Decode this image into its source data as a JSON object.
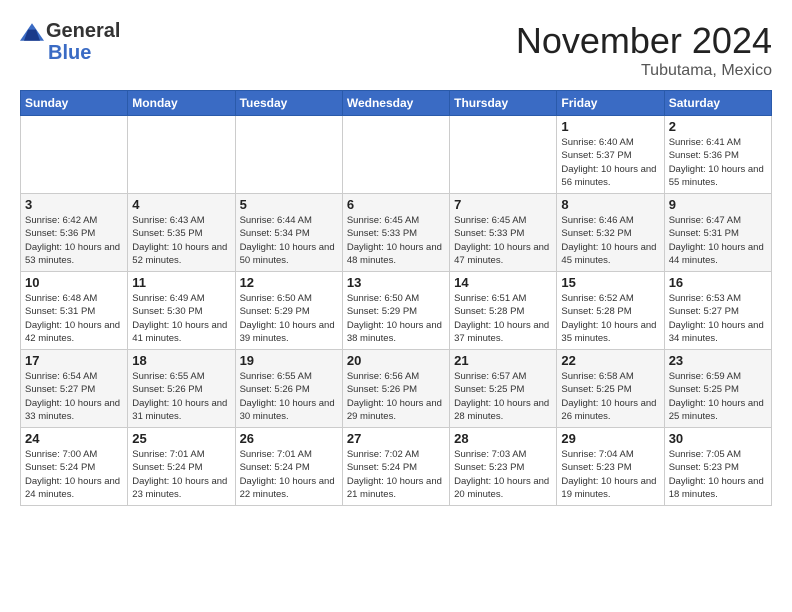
{
  "header": {
    "logo_general": "General",
    "logo_blue": "Blue",
    "month_title": "November 2024",
    "location": "Tubutama, Mexico"
  },
  "weekdays": [
    "Sunday",
    "Monday",
    "Tuesday",
    "Wednesday",
    "Thursday",
    "Friday",
    "Saturday"
  ],
  "weeks": [
    [
      {
        "day": "",
        "sunrise": "",
        "sunset": "",
        "daylight": ""
      },
      {
        "day": "",
        "sunrise": "",
        "sunset": "",
        "daylight": ""
      },
      {
        "day": "",
        "sunrise": "",
        "sunset": "",
        "daylight": ""
      },
      {
        "day": "",
        "sunrise": "",
        "sunset": "",
        "daylight": ""
      },
      {
        "day": "",
        "sunrise": "",
        "sunset": "",
        "daylight": ""
      },
      {
        "day": "1",
        "sunrise": "Sunrise: 6:40 AM",
        "sunset": "Sunset: 5:37 PM",
        "daylight": "Daylight: 10 hours and 56 minutes."
      },
      {
        "day": "2",
        "sunrise": "Sunrise: 6:41 AM",
        "sunset": "Sunset: 5:36 PM",
        "daylight": "Daylight: 10 hours and 55 minutes."
      }
    ],
    [
      {
        "day": "3",
        "sunrise": "Sunrise: 6:42 AM",
        "sunset": "Sunset: 5:36 PM",
        "daylight": "Daylight: 10 hours and 53 minutes."
      },
      {
        "day": "4",
        "sunrise": "Sunrise: 6:43 AM",
        "sunset": "Sunset: 5:35 PM",
        "daylight": "Daylight: 10 hours and 52 minutes."
      },
      {
        "day": "5",
        "sunrise": "Sunrise: 6:44 AM",
        "sunset": "Sunset: 5:34 PM",
        "daylight": "Daylight: 10 hours and 50 minutes."
      },
      {
        "day": "6",
        "sunrise": "Sunrise: 6:45 AM",
        "sunset": "Sunset: 5:33 PM",
        "daylight": "Daylight: 10 hours and 48 minutes."
      },
      {
        "day": "7",
        "sunrise": "Sunrise: 6:45 AM",
        "sunset": "Sunset: 5:33 PM",
        "daylight": "Daylight: 10 hours and 47 minutes."
      },
      {
        "day": "8",
        "sunrise": "Sunrise: 6:46 AM",
        "sunset": "Sunset: 5:32 PM",
        "daylight": "Daylight: 10 hours and 45 minutes."
      },
      {
        "day": "9",
        "sunrise": "Sunrise: 6:47 AM",
        "sunset": "Sunset: 5:31 PM",
        "daylight": "Daylight: 10 hours and 44 minutes."
      }
    ],
    [
      {
        "day": "10",
        "sunrise": "Sunrise: 6:48 AM",
        "sunset": "Sunset: 5:31 PM",
        "daylight": "Daylight: 10 hours and 42 minutes."
      },
      {
        "day": "11",
        "sunrise": "Sunrise: 6:49 AM",
        "sunset": "Sunset: 5:30 PM",
        "daylight": "Daylight: 10 hours and 41 minutes."
      },
      {
        "day": "12",
        "sunrise": "Sunrise: 6:50 AM",
        "sunset": "Sunset: 5:29 PM",
        "daylight": "Daylight: 10 hours and 39 minutes."
      },
      {
        "day": "13",
        "sunrise": "Sunrise: 6:50 AM",
        "sunset": "Sunset: 5:29 PM",
        "daylight": "Daylight: 10 hours and 38 minutes."
      },
      {
        "day": "14",
        "sunrise": "Sunrise: 6:51 AM",
        "sunset": "Sunset: 5:28 PM",
        "daylight": "Daylight: 10 hours and 37 minutes."
      },
      {
        "day": "15",
        "sunrise": "Sunrise: 6:52 AM",
        "sunset": "Sunset: 5:28 PM",
        "daylight": "Daylight: 10 hours and 35 minutes."
      },
      {
        "day": "16",
        "sunrise": "Sunrise: 6:53 AM",
        "sunset": "Sunset: 5:27 PM",
        "daylight": "Daylight: 10 hours and 34 minutes."
      }
    ],
    [
      {
        "day": "17",
        "sunrise": "Sunrise: 6:54 AM",
        "sunset": "Sunset: 5:27 PM",
        "daylight": "Daylight: 10 hours and 33 minutes."
      },
      {
        "day": "18",
        "sunrise": "Sunrise: 6:55 AM",
        "sunset": "Sunset: 5:26 PM",
        "daylight": "Daylight: 10 hours and 31 minutes."
      },
      {
        "day": "19",
        "sunrise": "Sunrise: 6:55 AM",
        "sunset": "Sunset: 5:26 PM",
        "daylight": "Daylight: 10 hours and 30 minutes."
      },
      {
        "day": "20",
        "sunrise": "Sunrise: 6:56 AM",
        "sunset": "Sunset: 5:26 PM",
        "daylight": "Daylight: 10 hours and 29 minutes."
      },
      {
        "day": "21",
        "sunrise": "Sunrise: 6:57 AM",
        "sunset": "Sunset: 5:25 PM",
        "daylight": "Daylight: 10 hours and 28 minutes."
      },
      {
        "day": "22",
        "sunrise": "Sunrise: 6:58 AM",
        "sunset": "Sunset: 5:25 PM",
        "daylight": "Daylight: 10 hours and 26 minutes."
      },
      {
        "day": "23",
        "sunrise": "Sunrise: 6:59 AM",
        "sunset": "Sunset: 5:25 PM",
        "daylight": "Daylight: 10 hours and 25 minutes."
      }
    ],
    [
      {
        "day": "24",
        "sunrise": "Sunrise: 7:00 AM",
        "sunset": "Sunset: 5:24 PM",
        "daylight": "Daylight: 10 hours and 24 minutes."
      },
      {
        "day": "25",
        "sunrise": "Sunrise: 7:01 AM",
        "sunset": "Sunset: 5:24 PM",
        "daylight": "Daylight: 10 hours and 23 minutes."
      },
      {
        "day": "26",
        "sunrise": "Sunrise: 7:01 AM",
        "sunset": "Sunset: 5:24 PM",
        "daylight": "Daylight: 10 hours and 22 minutes."
      },
      {
        "day": "27",
        "sunrise": "Sunrise: 7:02 AM",
        "sunset": "Sunset: 5:24 PM",
        "daylight": "Daylight: 10 hours and 21 minutes."
      },
      {
        "day": "28",
        "sunrise": "Sunrise: 7:03 AM",
        "sunset": "Sunset: 5:23 PM",
        "daylight": "Daylight: 10 hours and 20 minutes."
      },
      {
        "day": "29",
        "sunrise": "Sunrise: 7:04 AM",
        "sunset": "Sunset: 5:23 PM",
        "daylight": "Daylight: 10 hours and 19 minutes."
      },
      {
        "day": "30",
        "sunrise": "Sunrise: 7:05 AM",
        "sunset": "Sunset: 5:23 PM",
        "daylight": "Daylight: 10 hours and 18 minutes."
      }
    ]
  ]
}
